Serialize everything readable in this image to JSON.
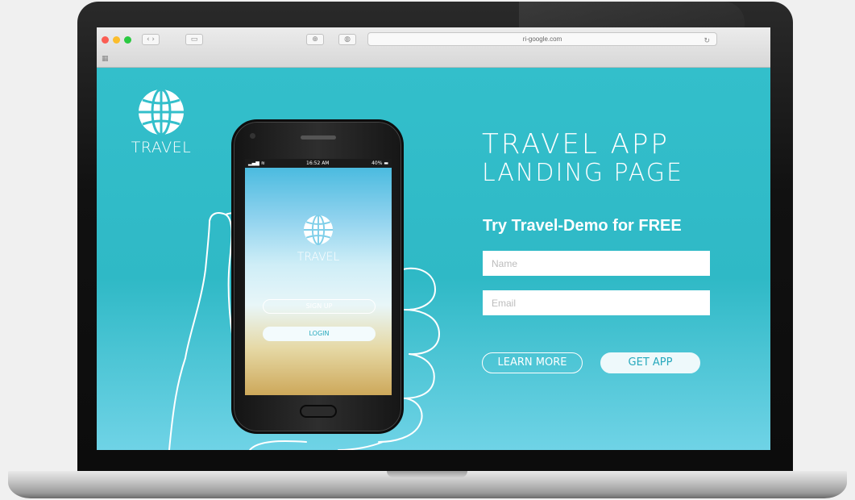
{
  "browser": {
    "address": "ri-google.com",
    "traffic_colors": [
      "#fb5d53",
      "#fbbd2c",
      "#2ac941"
    ]
  },
  "page": {
    "brand": {
      "icon": "globe-icon",
      "name": "TRAVEL"
    },
    "phone": {
      "status_time": "16:52 AM",
      "status_battery": "40%",
      "brand_name": "TRAVEL",
      "signup_label": "SIGN UP",
      "login_label": "LOGIN"
    },
    "headline": {
      "line1": "TRAVEL APP",
      "line2": "LANDING PAGE"
    },
    "cta_title": "Try Travel-Demo for FREE",
    "form": {
      "name_placeholder": "Name",
      "email_placeholder": "Email"
    },
    "buttons": {
      "learn_more": "LEARN MORE",
      "get_app": "GET APP"
    },
    "colors": {
      "accent": "#2fb9c6",
      "button_text": "#27a9bd"
    }
  }
}
